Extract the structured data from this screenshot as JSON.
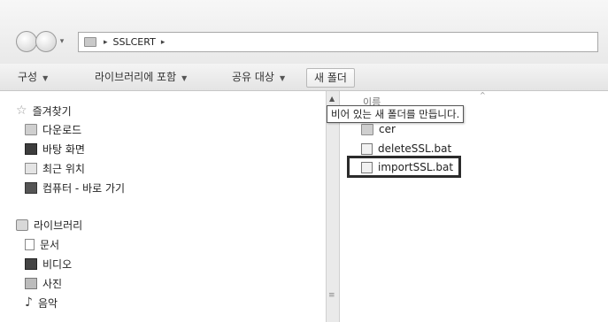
{
  "address_bar": {
    "path": "SSLCERT",
    "separator": "▸"
  },
  "toolbar": {
    "organize_label": "구성",
    "include_library_label": "라이브러리에 포함",
    "share_label": "공유 대상",
    "new_folder_label": "새 폴더",
    "caret": "▼"
  },
  "tooltip": {
    "text": "비어 있는 새 폴더를 만듭니다."
  },
  "nav_pane": {
    "favorites": {
      "label": "즐겨찾기",
      "items": [
        {
          "label": "다운로드",
          "icon": "downloads-folder-icon"
        },
        {
          "label": "바탕 화면",
          "icon": "desktop-icon"
        },
        {
          "label": "최근 위치",
          "icon": "recent-places-icon"
        },
        {
          "label": "컴퓨터 - 바로 가기",
          "icon": "computer-icon"
        }
      ]
    },
    "libraries": {
      "label": "라이브러리",
      "items": [
        {
          "label": "문서",
          "icon": "documents-icon"
        },
        {
          "label": "비디오",
          "icon": "videos-icon"
        },
        {
          "label": "사진",
          "icon": "pictures-icon"
        },
        {
          "label": "음악",
          "icon": "music-icon"
        }
      ]
    }
  },
  "file_list": {
    "column_name_header": "이름",
    "files": [
      {
        "name": "cer",
        "type": "folder"
      },
      {
        "name": "deleteSSL.bat",
        "type": "bat"
      },
      {
        "name": "importSSL.bat",
        "type": "bat",
        "highlighted": true
      }
    ]
  }
}
